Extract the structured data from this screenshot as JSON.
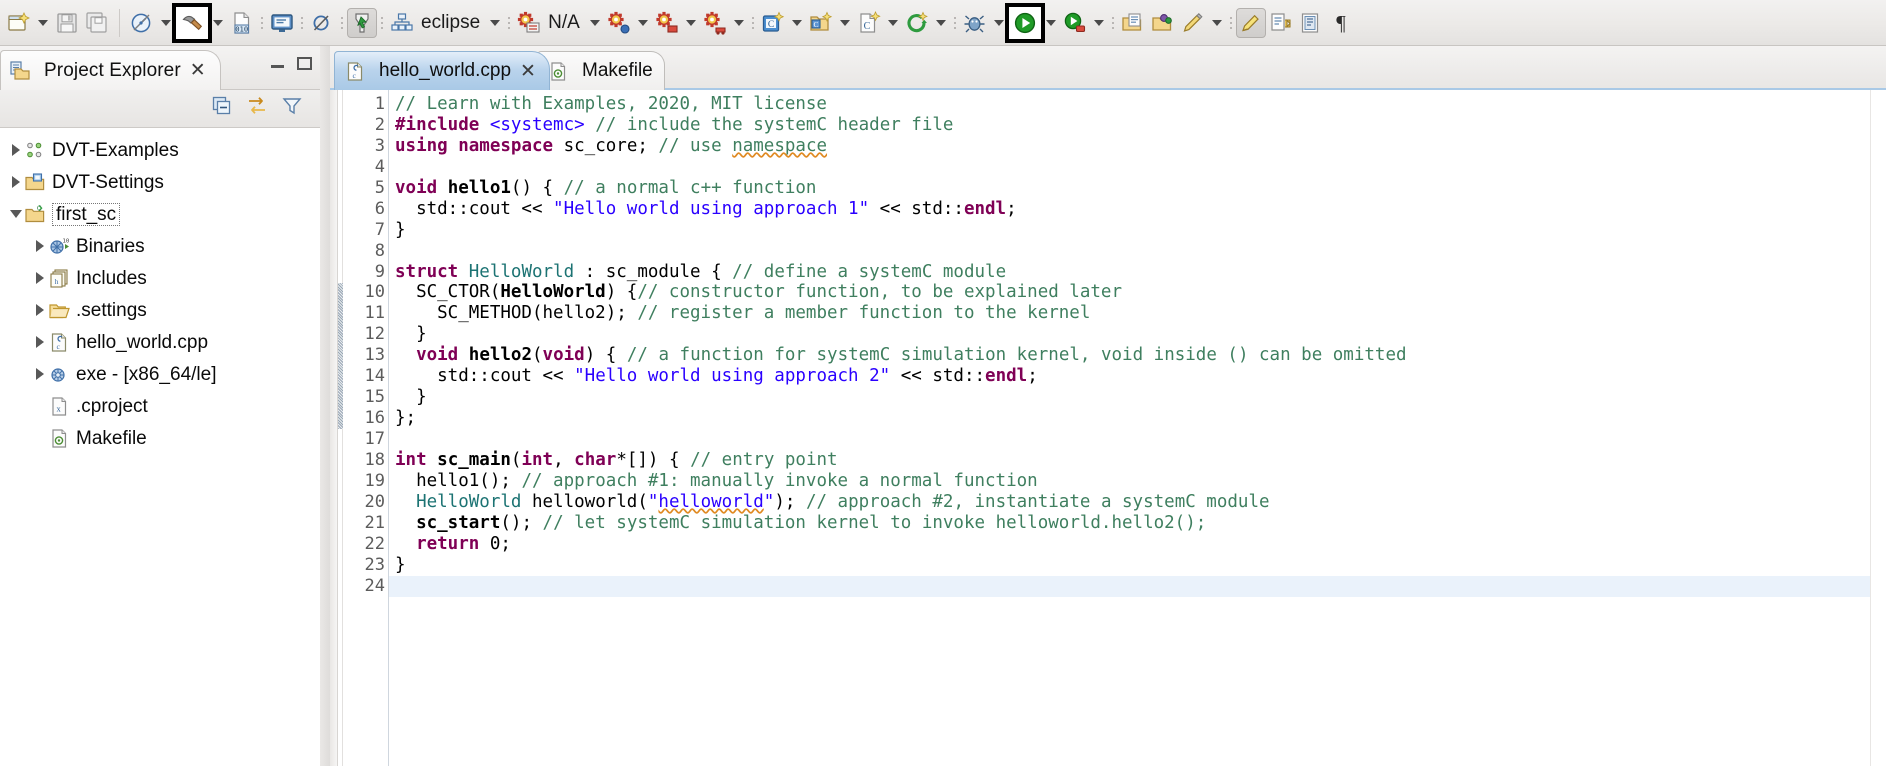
{
  "toolbar": {
    "items": [
      {
        "name": "new-wizard-icon",
        "kind": "icon",
        "glyph": "new",
        "arrow": true
      },
      {
        "name": "save-icon",
        "kind": "icon",
        "glyph": "save",
        "arrow": false
      },
      {
        "name": "save-all-icon",
        "kind": "icon",
        "glyph": "save-all",
        "arrow": false
      },
      {
        "name": "separator",
        "kind": "sep"
      },
      {
        "name": "build-all-icon",
        "kind": "icon",
        "glyph": "build-all",
        "arrow": true
      },
      {
        "name": "build-hammer-icon",
        "kind": "icon",
        "glyph": "hammer",
        "arrow": true,
        "framed": true
      },
      {
        "name": "build-binary-icon",
        "kind": "icon",
        "glyph": "binary010",
        "arrow": false
      },
      {
        "name": "dots",
        "kind": "dots"
      },
      {
        "name": "open-console-icon",
        "kind": "icon",
        "glyph": "console",
        "arrow": false
      },
      {
        "name": "dots",
        "kind": "dots"
      },
      {
        "name": "skip-breakpoints-icon",
        "kind": "icon",
        "glyph": "skip-bp",
        "arrow": false
      },
      {
        "name": "dots",
        "kind": "dots"
      },
      {
        "name": "dvt-compile-icon",
        "kind": "icon",
        "glyph": "dvt-compile",
        "arrow": false,
        "pressed": true
      },
      {
        "name": "dots",
        "kind": "dots"
      },
      {
        "name": "dvt-hierarchy-icon",
        "kind": "icon",
        "glyph": "hierarchy",
        "arrow": false
      },
      {
        "name": "build-config-label",
        "kind": "label",
        "label": "eclipse",
        "arrow": true
      },
      {
        "name": "dots",
        "kind": "dots"
      },
      {
        "name": "dvt-config-icon",
        "kind": "icon",
        "glyph": "gears-list",
        "arrow": false
      },
      {
        "name": "dvt-status-label",
        "kind": "label",
        "label": "N/A",
        "arrow": true
      },
      {
        "name": "dvt-gears2-icon",
        "kind": "icon",
        "glyph": "gears-blue",
        "arrow": true
      },
      {
        "name": "dvt-gears3-icon",
        "kind": "icon",
        "glyph": "gears-dot",
        "arrow": true
      },
      {
        "name": "dvt-gears4-icon",
        "kind": "icon",
        "glyph": "gears-red",
        "arrow": true
      },
      {
        "name": "dots",
        "kind": "dots"
      },
      {
        "name": "new-class-icon",
        "kind": "icon",
        "glyph": "new-class",
        "arrow": true
      },
      {
        "name": "new-folder-c-icon",
        "kind": "icon",
        "glyph": "new-folder-c",
        "arrow": true
      },
      {
        "name": "new-source-file-icon",
        "kind": "icon",
        "glyph": "new-file-c",
        "arrow": true
      },
      {
        "name": "new-target-icon",
        "kind": "icon",
        "glyph": "new-target",
        "arrow": true
      },
      {
        "name": "dots",
        "kind": "dots"
      },
      {
        "name": "debug-icon",
        "kind": "icon",
        "glyph": "debug-bug",
        "arrow": true
      },
      {
        "name": "run-icon",
        "kind": "icon",
        "glyph": "run-play",
        "arrow": true,
        "framed": true
      },
      {
        "name": "profile-icon",
        "kind": "icon",
        "glyph": "profile",
        "arrow": true
      },
      {
        "name": "dots",
        "kind": "dots"
      },
      {
        "name": "open-element-icon",
        "kind": "icon",
        "glyph": "open-elem",
        "arrow": false
      },
      {
        "name": "open-type-icon",
        "kind": "icon",
        "glyph": "open-type",
        "arrow": false
      },
      {
        "name": "search-pen-icon",
        "kind": "icon",
        "glyph": "pen",
        "arrow": true
      },
      {
        "name": "dots",
        "kind": "dots"
      },
      {
        "name": "toggle-mark-occurrences-icon",
        "kind": "icon",
        "glyph": "marker-pen",
        "arrow": false,
        "pressed": true
      },
      {
        "name": "next-annotation-icon",
        "kind": "icon",
        "glyph": "next-annot",
        "arrow": false
      },
      {
        "name": "show-whitespace-icon",
        "kind": "icon",
        "glyph": "whitespace",
        "arrow": false
      },
      {
        "name": "pilcrow-icon",
        "kind": "icon",
        "glyph": "pilcrow",
        "arrow": false
      }
    ]
  },
  "project_explorer": {
    "tab_title": "Project Explorer",
    "tab_close": "✕",
    "view_buttons": [
      {
        "name": "collapse-all-button",
        "glyph": "collapse-all"
      },
      {
        "name": "link-with-editor-button",
        "glyph": "link-editor"
      },
      {
        "name": "view-menu-filter-button",
        "glyph": "filter"
      }
    ],
    "tree": [
      {
        "label": "DVT-Examples",
        "indent": 0,
        "twisty": "collapsed",
        "icon": "dvt-examples-icon",
        "selected": false
      },
      {
        "label": "DVT-Settings",
        "indent": 0,
        "twisty": "collapsed",
        "icon": "dvt-settings-icon",
        "selected": false
      },
      {
        "label": "first_sc",
        "indent": 0,
        "twisty": "expanded",
        "icon": "c-project-icon",
        "selected": true
      },
      {
        "label": "Binaries",
        "indent": 1,
        "twisty": "collapsed",
        "icon": "binaries-icon",
        "selected": false
      },
      {
        "label": "Includes",
        "indent": 1,
        "twisty": "collapsed",
        "icon": "includes-icon",
        "selected": false
      },
      {
        "label": ".settings",
        "indent": 1,
        "twisty": "collapsed",
        "icon": "folder-icon",
        "selected": false
      },
      {
        "label": "hello_world.cpp",
        "indent": 1,
        "twisty": "collapsed",
        "icon": "cpp-file-icon",
        "selected": false
      },
      {
        "label": "exe - [x86_64/le]",
        "indent": 1,
        "twisty": "collapsed",
        "icon": "executable-icon",
        "selected": false
      },
      {
        "label": ".cproject",
        "indent": 1,
        "twisty": "none",
        "icon": "xml-file-icon",
        "selected": false
      },
      {
        "label": "Makefile",
        "indent": 1,
        "twisty": "none",
        "icon": "makefile-icon",
        "selected": false
      }
    ]
  },
  "editor": {
    "tabs": [
      {
        "label": "hello_world.cpp",
        "icon": "cpp-file-icon",
        "active": true,
        "close": "✕"
      },
      {
        "label": "Makefile",
        "icon": "makefile-icon",
        "active": false,
        "close": ""
      }
    ],
    "first_line": 1,
    "current_line": 24,
    "change_bar_lines": [
      10,
      11,
      12,
      13,
      14,
      15,
      16
    ],
    "fold_lines": [
      5,
      9,
      10,
      13,
      18
    ],
    "lines": [
      {
        "n": 1,
        "tokens": [
          {
            "t": "// Learn with Examples, 2020, MIT license",
            "c": "cm"
          }
        ]
      },
      {
        "n": 2,
        "tokens": [
          {
            "t": "#include",
            "c": "pp"
          },
          {
            "t": " ",
            "c": ""
          },
          {
            "t": "<systemc>",
            "c": "hdr"
          },
          {
            "t": " ",
            "c": ""
          },
          {
            "t": "// include the systemC header file",
            "c": "cm"
          }
        ]
      },
      {
        "n": 3,
        "tokens": [
          {
            "t": "using",
            "c": "kw"
          },
          {
            "t": " ",
            "c": ""
          },
          {
            "t": "namespace",
            "c": "kw"
          },
          {
            "t": " sc_core; ",
            "c": ""
          },
          {
            "t": "// use ",
            "c": "cm"
          },
          {
            "t": "namespace",
            "c": "cm sq"
          }
        ]
      },
      {
        "n": 4,
        "tokens": []
      },
      {
        "n": 5,
        "tokens": [
          {
            "t": "void",
            "c": "kw"
          },
          {
            "t": " ",
            "c": ""
          },
          {
            "t": "hello1",
            "c": "fn"
          },
          {
            "t": "() { ",
            "c": ""
          },
          {
            "t": "// a normal c++ function",
            "c": "cm"
          }
        ]
      },
      {
        "n": 6,
        "tokens": [
          {
            "t": "  std::cout << ",
            "c": ""
          },
          {
            "t": "\"Hello world using approach 1\"",
            "c": "st"
          },
          {
            "t": " << std::",
            "c": ""
          },
          {
            "t": "endl",
            "c": "kw"
          },
          {
            "t": ";",
            "c": ""
          }
        ]
      },
      {
        "n": 7,
        "tokens": [
          {
            "t": "}",
            "c": ""
          }
        ]
      },
      {
        "n": 8,
        "tokens": []
      },
      {
        "n": 9,
        "tokens": [
          {
            "t": "struct",
            "c": "kw"
          },
          {
            "t": " ",
            "c": ""
          },
          {
            "t": "HelloWorld",
            "c": "ty"
          },
          {
            "t": " : sc_module { ",
            "c": ""
          },
          {
            "t": "// define a systemC module",
            "c": "cm"
          }
        ]
      },
      {
        "n": 10,
        "tokens": [
          {
            "t": "  SC_CTOR(",
            "c": ""
          },
          {
            "t": "HelloWorld",
            "c": "fn"
          },
          {
            "t": ") {",
            "c": ""
          },
          {
            "t": "// constructor function, to be explained later",
            "c": "cm"
          }
        ]
      },
      {
        "n": 11,
        "tokens": [
          {
            "t": "    SC_METHOD(hello2); ",
            "c": ""
          },
          {
            "t": "// register a member function to the kernel",
            "c": "cm"
          }
        ]
      },
      {
        "n": 12,
        "tokens": [
          {
            "t": "  }",
            "c": ""
          }
        ]
      },
      {
        "n": 13,
        "tokens": [
          {
            "t": "  ",
            "c": ""
          },
          {
            "t": "void",
            "c": "kw"
          },
          {
            "t": " ",
            "c": ""
          },
          {
            "t": "hello2",
            "c": "fn"
          },
          {
            "t": "(",
            "c": ""
          },
          {
            "t": "void",
            "c": "kw"
          },
          {
            "t": ") { ",
            "c": ""
          },
          {
            "t": "// a function for systemC simulation kernel, void inside () can be omitted",
            "c": "cm"
          }
        ]
      },
      {
        "n": 14,
        "tokens": [
          {
            "t": "    std::cout << ",
            "c": ""
          },
          {
            "t": "\"Hello world using approach 2\"",
            "c": "st"
          },
          {
            "t": " << std::",
            "c": ""
          },
          {
            "t": "endl",
            "c": "kw"
          },
          {
            "t": ";",
            "c": ""
          }
        ]
      },
      {
        "n": 15,
        "tokens": [
          {
            "t": "  }",
            "c": ""
          }
        ]
      },
      {
        "n": 16,
        "tokens": [
          {
            "t": "};",
            "c": ""
          }
        ]
      },
      {
        "n": 17,
        "tokens": []
      },
      {
        "n": 18,
        "tokens": [
          {
            "t": "int",
            "c": "kw"
          },
          {
            "t": " ",
            "c": ""
          },
          {
            "t": "sc_main",
            "c": "fn"
          },
          {
            "t": "(",
            "c": ""
          },
          {
            "t": "int",
            "c": "kw"
          },
          {
            "t": ", ",
            "c": ""
          },
          {
            "t": "char",
            "c": "kw"
          },
          {
            "t": "*[]) { ",
            "c": ""
          },
          {
            "t": "// entry point",
            "c": "cm"
          }
        ]
      },
      {
        "n": 19,
        "tokens": [
          {
            "t": "  hello1(); ",
            "c": ""
          },
          {
            "t": "// approach #1: manually invoke a normal function",
            "c": "cm"
          }
        ]
      },
      {
        "n": 20,
        "tokens": [
          {
            "t": "  ",
            "c": ""
          },
          {
            "t": "HelloWorld",
            "c": "ty"
          },
          {
            "t": " helloworld(",
            "c": ""
          },
          {
            "t": "\"",
            "c": "st"
          },
          {
            "t": "helloworld",
            "c": "st sq"
          },
          {
            "t": "\"",
            "c": "st"
          },
          {
            "t": "); ",
            "c": ""
          },
          {
            "t": "// approach #2, instantiate a systemC module",
            "c": "cm"
          }
        ]
      },
      {
        "n": 21,
        "tokens": [
          {
            "t": "  ",
            "c": ""
          },
          {
            "t": "sc_start",
            "c": "fn"
          },
          {
            "t": "(); ",
            "c": ""
          },
          {
            "t": "// let systemC simulation kernel to invoke helloworld.hello2();",
            "c": "cm"
          }
        ]
      },
      {
        "n": 22,
        "tokens": [
          {
            "t": "  ",
            "c": ""
          },
          {
            "t": "return",
            "c": "kw"
          },
          {
            "t": " 0;",
            "c": ""
          }
        ]
      },
      {
        "n": 23,
        "tokens": [
          {
            "t": "}",
            "c": ""
          }
        ]
      },
      {
        "n": 24,
        "tokens": []
      }
    ]
  },
  "colors": {
    "keyword": "#7f0055",
    "comment": "#3f7f5f",
    "string": "#2a00ff",
    "type": "#1c7373",
    "active_tab_blue": "#a9c9e6",
    "current_line": "#eaf2fb",
    "spellcheck": "#e08a22",
    "run_green": "#1f9b27"
  }
}
